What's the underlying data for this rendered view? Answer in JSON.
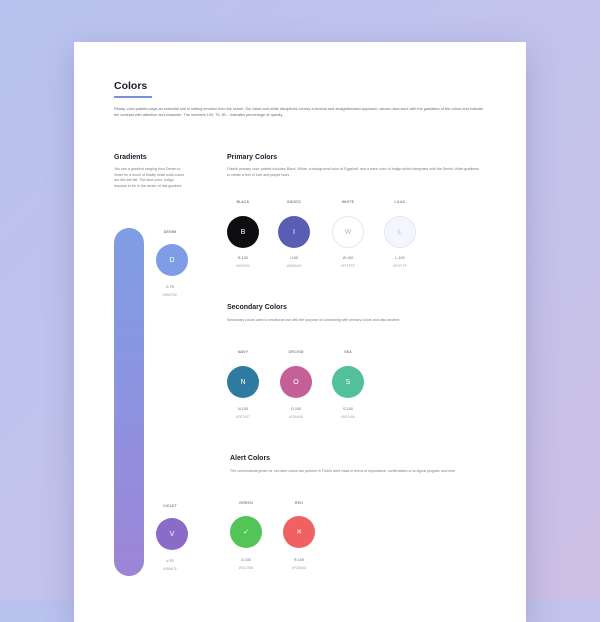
{
  "page": {
    "title": "Colors",
    "intro": "Ready, color palette plays an essential role in setting emotion from the scene. Our black and white disciplines convey a serious and straightforward approach, whose uses work with the gradation of the colors and indicate the contrast with attention and character. The numbers 100, 75, 50... indicates percentage of opacity."
  },
  "gradients": {
    "heading": "Gradients",
    "desc": "You use a gradient ranging from Denim to Violet for a touch of fluidity while solid colors are like the flat. The blue color, Indigo, requires to be in the center of this gradient.",
    "top": {
      "label": "DENIM",
      "glyph": "D",
      "value": "0.75",
      "hex": "#96A7DE",
      "color": "#7e9de4"
    },
    "bottom": {
      "label": "VIOLET",
      "glyph": "V",
      "value": "v.70",
      "hex": "#9884CE",
      "color": "#8a6cc8"
    }
  },
  "primary": {
    "heading": "Primary Colors",
    "desc": "Giselle primary color palette includes Black, White, a background color of Eggshell, and a base color of Indigo which integrates with the Denim-Violet gradients to create a feel of love and purple hues.",
    "swatches": [
      {
        "label": "BLACK",
        "glyph": "B",
        "value": "B.100",
        "hex": "#000000",
        "color": "#0d0d12",
        "light": false
      },
      {
        "label": "INDIGO",
        "glyph": "I",
        "value": "I.100",
        "hex": "#5B5DA9",
        "color": "#5b5db4",
        "light": false
      },
      {
        "label": "WHITE",
        "glyph": "W",
        "value": "W.100",
        "hex": "#FFFFFF",
        "color": "#ffffff",
        "light": true
      },
      {
        "label": "LILAC",
        "glyph": "L",
        "value": "L.100",
        "hex": "#F1F1FF",
        "color": "#f5f5ff",
        "light": true
      }
    ]
  },
  "secondary": {
    "heading": "Secondary Colors",
    "desc": "Secondary colors used to emotional use with the purpose of contrasting with primary colors and also another.",
    "swatches": [
      {
        "label": "NAVY",
        "glyph": "N",
        "value": "N.100",
        "hex": "#2E7A97",
        "color": "#2f7aa0"
      },
      {
        "label": "ORCHID",
        "glyph": "O",
        "value": "O.100",
        "hex": "#C96A9A",
        "color": "#c45f98"
      },
      {
        "label": "SEA",
        "glyph": "S",
        "value": "S.100",
        "hex": "#56C49A",
        "color": "#52c09a"
      }
    ]
  },
  "alert": {
    "heading": "Alert Colors",
    "desc": "The conventional green vs. red alert colors are present in Fluid's alert class in terms of importance, confirmation or to signal program and else.",
    "swatches": [
      {
        "label": "GREEN",
        "glyph": "✓",
        "value": "G.100",
        "hex": "#5AC95B",
        "color": "#55c458"
      },
      {
        "label": "RED",
        "glyph": "✕",
        "value": "R.100",
        "hex": "#F26A6A",
        "color": "#f06262"
      }
    ]
  }
}
